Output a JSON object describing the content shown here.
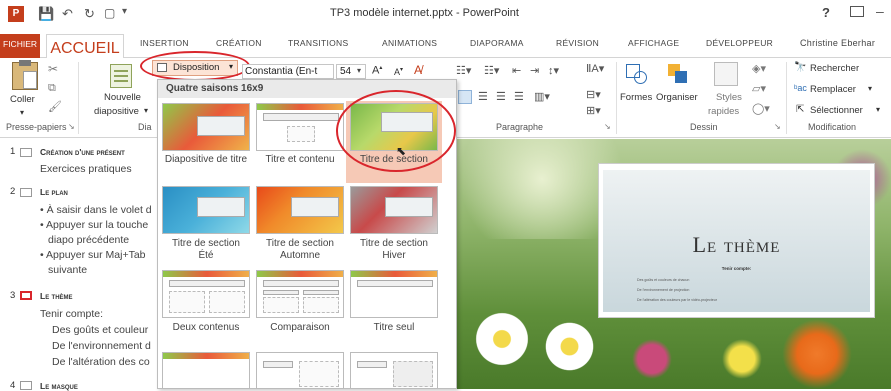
{
  "app": {
    "title": "TP3 modèle internet.pptx - PowerPoint",
    "help": "?",
    "restore_icon": "ribbon-display-icon"
  },
  "tabs": [
    {
      "label": "FICHIER"
    },
    {
      "label": "ACCUEIL"
    },
    {
      "label": "INSERTION"
    },
    {
      "label": "CRÉATION"
    },
    {
      "label": "TRANSITIONS"
    },
    {
      "label": "ANIMATIONS"
    },
    {
      "label": "DIAPORAMA"
    },
    {
      "label": "RÉVISION"
    },
    {
      "label": "AFFICHAGE"
    },
    {
      "label": "DÉVELOPPEUR"
    },
    {
      "label": "Christine Eberhar"
    }
  ],
  "ribbon": {
    "coller": "Coller",
    "nouvelle1": "Nouvelle",
    "nouvelle2": "diapositive",
    "disposition": "Disposition",
    "font_name": "Constantia (En-t",
    "font_size": "54",
    "formes": "Formes",
    "organiser": "Organiser",
    "styles1": "Styles",
    "styles2": "rapides",
    "rechercher": "Rechercher",
    "remplacer": "Remplacer",
    "selectionner": "Sélectionner",
    "groups": {
      "presse": "Presse-papiers",
      "dia": "Dia",
      "paragraphe": "Paragraphe",
      "dessin": "Dessin",
      "modification": "Modification"
    }
  },
  "dropdown": {
    "header": "Quatre saisons 16x9",
    "layouts": [
      {
        "label1": "Diapositive de titre",
        "label2": ""
      },
      {
        "label1": "Titre et contenu",
        "label2": ""
      },
      {
        "label1": "Titre de section",
        "label2": ""
      },
      {
        "label1": "Titre de section",
        "label2": "Été"
      },
      {
        "label1": "Titre de section",
        "label2": "Automne"
      },
      {
        "label1": "Titre de section",
        "label2": "Hiver"
      },
      {
        "label1": "Deux contenus",
        "label2": ""
      },
      {
        "label1": "Comparaison",
        "label2": ""
      },
      {
        "label1": "Titre seul",
        "label2": ""
      }
    ]
  },
  "slides_pane": {
    "items": [
      {
        "num": "1",
        "title": "Création d'une présent",
        "lines": [
          "Exercices pratiques"
        ]
      },
      {
        "num": "2",
        "title": "Le plan",
        "lines": [
          "• À saisir dans le volet d",
          "• Appuyer sur la touche",
          "diapo précédente",
          "• Appuyer sur Maj+Tab",
          "suivante"
        ]
      },
      {
        "num": "3",
        "title": "Le thème",
        "lines": [
          "Tenir compte:",
          "Des goûts et couleur",
          "De l'environnement d",
          "De l'altération des co"
        ]
      },
      {
        "num": "4",
        "title": "Le masque",
        "lines": []
      }
    ]
  },
  "slide": {
    "title": "Le thème",
    "subtitle": "Tenir compte:",
    "bullets": [
      "Des goûts et couleurs de chacun",
      "De l'environnement de projection",
      "De l'altération des couleurs par le vidéo-projecteur"
    ]
  },
  "colors": {
    "accent": "#c43e1c",
    "highlight_circle": "#d9262c",
    "selected_tile": "#f6c9b6"
  }
}
